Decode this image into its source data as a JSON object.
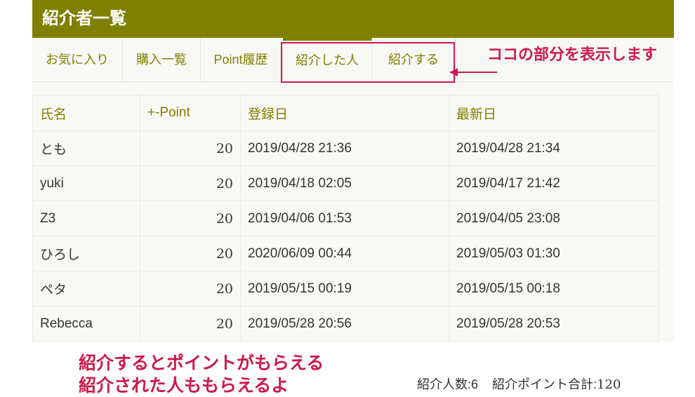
{
  "header": {
    "title": "紹介者一覧"
  },
  "tabs": [
    {
      "label": "お気に入り"
    },
    {
      "label": "購入一覧"
    },
    {
      "label": "Point履歴"
    },
    {
      "label": "紹介した人",
      "active": true
    },
    {
      "label": "紹介する"
    }
  ],
  "callout": {
    "text": "ココの部分を表示します"
  },
  "table": {
    "columns": [
      "氏名",
      "+-Point",
      "登録日",
      "最新日"
    ],
    "rows": [
      {
        "name": "とも",
        "point": "20",
        "registered": "2019/04/28 21:36",
        "latest": "2019/04/28 21:34"
      },
      {
        "name": "yuki",
        "point": "20",
        "registered": "2019/04/18 02:05",
        "latest": "2019/04/17 21:42"
      },
      {
        "name": "Z3",
        "point": "20",
        "registered": "2019/04/06 01:53",
        "latest": "2019/04/05 23:08"
      },
      {
        "name": "ひろし",
        "point": "20",
        "registered": "2020/06/09 00:44",
        "latest": "2019/05/03 01:30"
      },
      {
        "name": "ペタ",
        "point": "20",
        "registered": "2019/05/15 00:19",
        "latest": "2019/05/15 00:18"
      },
      {
        "name": "Rebecca",
        "point": "20",
        "registered": "2019/05/28 20:56",
        "latest": "2019/05/28 20:53"
      }
    ]
  },
  "promo": {
    "line1": "紹介するとポイントがもらえる",
    "line2": "紹介された人ももらえるよ"
  },
  "summary": {
    "count_label": "紹介人数:",
    "count": "6",
    "total_label": "紹介ポイント合計:",
    "total": "120"
  },
  "colors": {
    "accent": "#808000",
    "annotation": "#cc1a4a",
    "panel": "#f8f8f4"
  }
}
